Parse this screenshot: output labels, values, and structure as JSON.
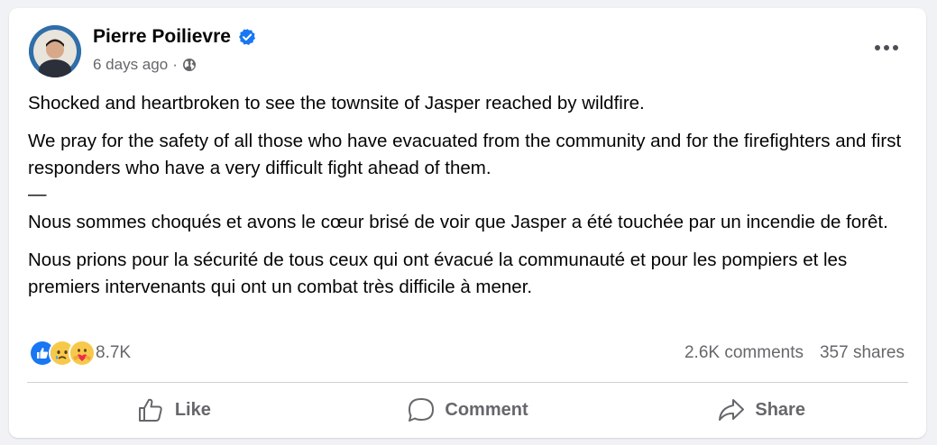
{
  "post": {
    "author": "Pierre Poilievre",
    "time": "6 days ago",
    "separator": "·",
    "audience_icon": "globe-icon",
    "verified_icon": "verified-badge-icon",
    "more_icon": "more-options-icon",
    "paragraphs": [
      "Shocked and heartbroken to see the townsite of Jasper reached by wildfire.",
      "We pray for the safety of all those who have evacuated from the community and for the firefighters and first responders who have a very difficult fight ahead of them.",
      "—",
      "Nous sommes choqués et avons le cœur brisé de voir que Jasper a été touchée par un incendie de forêt.",
      "Nous prions pour la sécurité de tous ceux qui ont évacué la communauté et pour les pompiers et les premiers intervenants qui ont un combat très difficile à mener."
    ]
  },
  "stats": {
    "reactions": [
      "like-reaction-icon",
      "sad-reaction-icon",
      "care-reaction-icon"
    ],
    "reaction_count": "8.7K",
    "comments": "2.6K comments",
    "shares": "357 shares"
  },
  "actions": {
    "like": "Like",
    "comment": "Comment",
    "share": "Share"
  },
  "colors": {
    "accent": "#1877f2",
    "secondary_text": "#65676b",
    "background": "#f0f2f5"
  }
}
